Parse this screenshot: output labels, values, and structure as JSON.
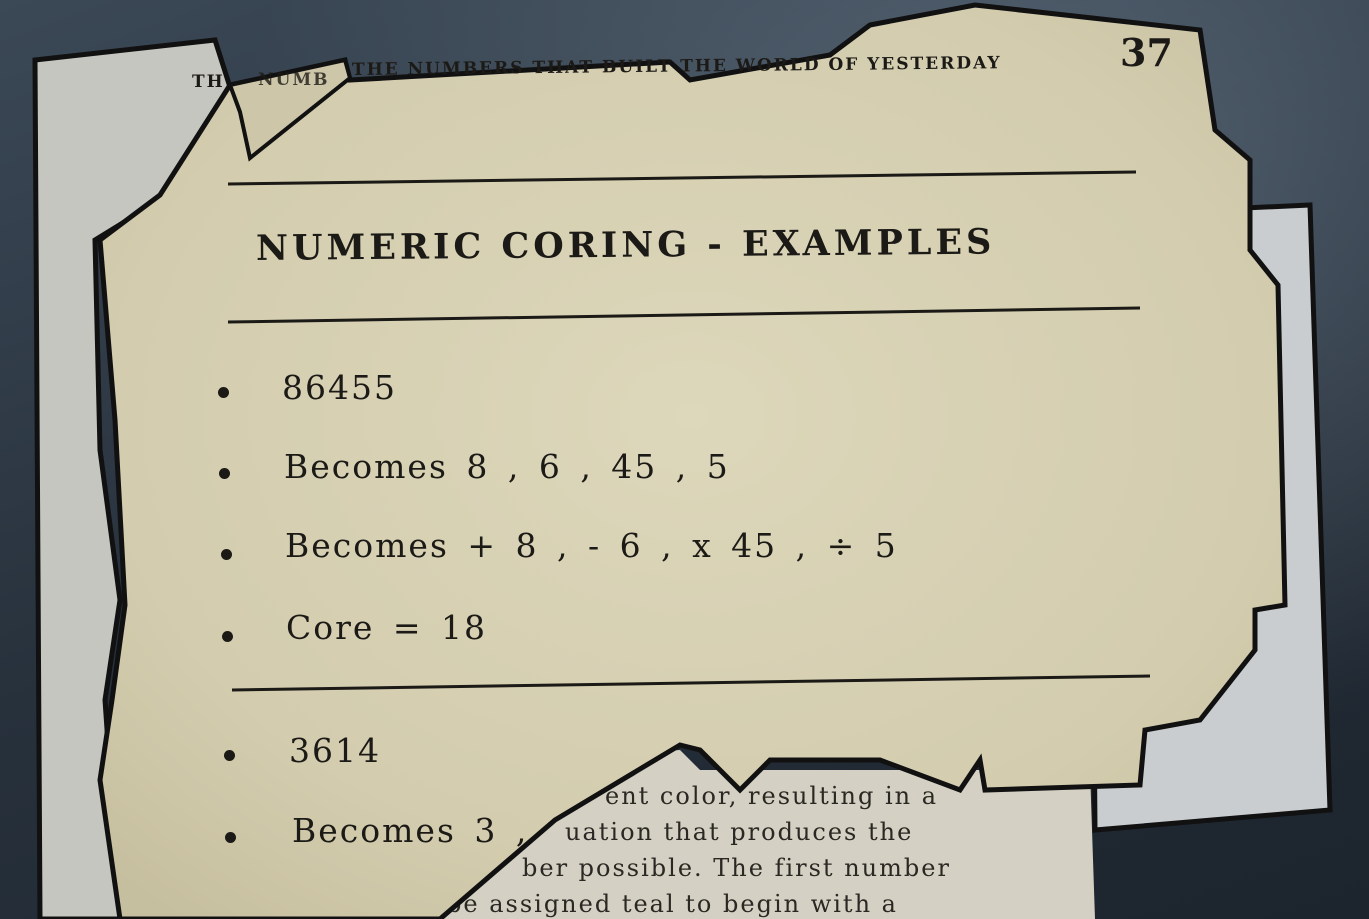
{
  "page": {
    "header": "THE NUMBERS THAT BUILT THE WORLD OF YESTERDAY",
    "header_partial_left": "TH",
    "header_partial_mid": "NUMB",
    "page_number": "37",
    "title": "NUMERIC CORING - EXAMPLES"
  },
  "examples": [
    {
      "items": [
        "86455",
        "Becomes 8 , 6 , 45 , 5",
        "Becomes + 8 , - 6 , x 45 , ÷ 5",
        "Core = 18"
      ]
    },
    {
      "items": [
        "3614",
        "Becomes 3 ,"
      ]
    }
  ],
  "underlying_page": {
    "lines": [
      "ent color, resulting in a",
      "uation that produces the",
      "ber possible. The first number",
      "be assigned teal to begin with a"
    ]
  },
  "colors": {
    "paper": "#d8d2b4",
    "paper_back": "#cfcfca",
    "ink": "#1c1a16",
    "outline": "#111111",
    "background": "#2a3440"
  }
}
